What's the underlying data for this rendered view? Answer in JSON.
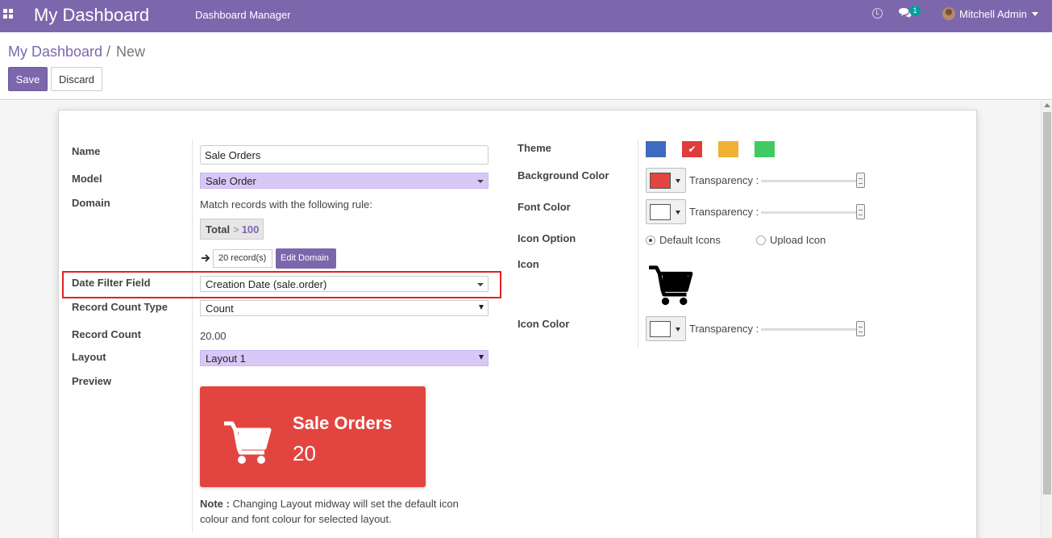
{
  "navbar": {
    "brand": "My Dashboard",
    "menu_item": "Dashboard Manager",
    "chat_count": "1",
    "user_name": "Mitchell Admin"
  },
  "breadcrumb": {
    "root": "My Dashboard",
    "separator": "/",
    "current": "New"
  },
  "buttons": {
    "save": "Save",
    "discard": "Discard"
  },
  "form": {
    "name_label": "Name",
    "name_value": "Sale Orders",
    "model_label": "Model",
    "model_value": "Sale Order",
    "domain_label": "Domain",
    "domain_hint": "Match records with the following rule:",
    "domain_rule": {
      "field": "Total",
      "operator": ">",
      "value": "100"
    },
    "records_count": "20 record(s)",
    "edit_domain": "Edit Domain",
    "date_filter_label": "Date Filter Field",
    "date_filter_value": "Creation Date (sale.order)",
    "record_count_type_label": "Record Count Type",
    "record_count_type_value": "Count",
    "record_count_label": "Record Count",
    "record_count_value": "20.00",
    "layout_label": "Layout",
    "layout_value": "Layout 1",
    "preview_label": "Preview",
    "preview": {
      "title": "Sale Orders",
      "count": "20",
      "bg_color": "#e2453f"
    },
    "note_label": "Note :",
    "note_text": "Changing Layout midway will set the default icon colour and font colour for selected layout."
  },
  "appearance": {
    "theme_label": "Theme",
    "themes": [
      {
        "color": "#3f6ac2",
        "selected": false
      },
      {
        "color": "#e03c3c",
        "selected": true
      },
      {
        "color": "#efb234",
        "selected": false
      },
      {
        "color": "#3fcb61",
        "selected": false
      }
    ],
    "bg_color_label": "Background Color",
    "bg_color": "#e2453f",
    "font_color_label": "Font Color",
    "font_color": "#ffffff",
    "transparency_label": "Transparency :",
    "transparency_level": 1.0,
    "icon_option_label": "Icon Option",
    "icon_options": [
      "Default Icons",
      "Upload Icon"
    ],
    "icon_option_selected": "Default Icons",
    "icon_label": "Icon",
    "icon_name": "shopping-cart-icon",
    "icon_color_label": "Icon Color",
    "icon_color": "#ffffff"
  }
}
